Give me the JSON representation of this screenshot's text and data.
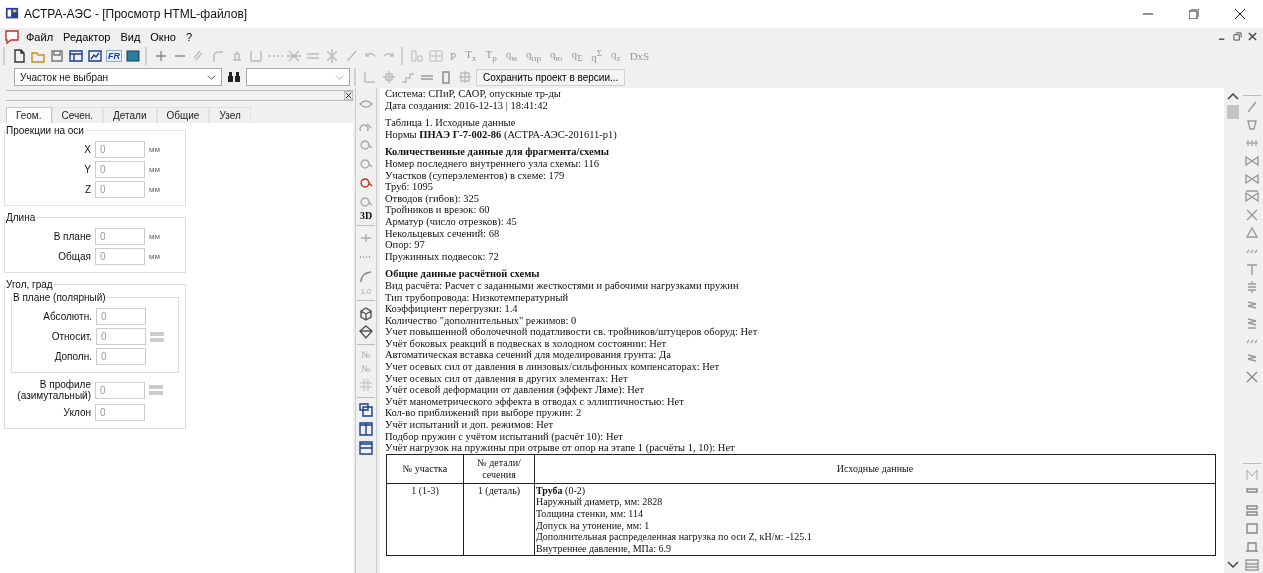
{
  "window": {
    "title": "АСТРА-АЭС - [Просмотр HTML-файлов]"
  },
  "menu": [
    "Файл",
    "Редактор",
    "Вид",
    "Окно",
    "?"
  ],
  "toolbar": {
    "logo_label": "FR",
    "text_buttons": [
      "P",
      "T$_{x}$",
      "T$_{p}$",
      "q$_{м}$",
      "q$_{пр}$",
      "q$_{ю}$",
      "q$_{Σ}$",
      "q$^{Σ}$",
      "q$_{z}$",
      "DxS"
    ]
  },
  "section_combo": {
    "value": "Участок не выбран"
  },
  "save_button": "Сохранить проект в версии...",
  "panel_tabs": [
    {
      "label": "Геом.",
      "selected": true
    },
    {
      "label": "Сечен.",
      "selected": false
    },
    {
      "label": "Детали",
      "selected": false
    },
    {
      "label": "Общие",
      "selected": false
    },
    {
      "label": "Узел",
      "selected": false
    }
  ],
  "groups": [
    {
      "title": "Проекции на оси",
      "fields": [
        {
          "label": "X",
          "value": "0",
          "unit": "мм",
          "spinner": false
        },
        {
          "label": "Y",
          "value": "0",
          "unit": "мм",
          "spinner": false
        },
        {
          "label": "Z",
          "value": "0",
          "unit": "мм",
          "spinner": false
        }
      ]
    },
    {
      "title": "Длина",
      "fields": [
        {
          "label": "В плане",
          "value": "0",
          "unit": "мм",
          "spinner": false
        },
        {
          "label": "Общая",
          "value": "0",
          "unit": "мм",
          "spinner": false
        }
      ]
    },
    {
      "title": "Угол, град",
      "subgroup": {
        "title": "В плане (полярный)",
        "fields": [
          {
            "label": "Абсолютн.",
            "value": "0",
            "spinner": false
          },
          {
            "label": "Относит.",
            "value": "0",
            "spinner": true
          },
          {
            "label": "Дополн.",
            "value": "0",
            "spinner": false
          }
        ]
      },
      "fields": [
        {
          "label": "В профиле (азимутальный)",
          "value": "0",
          "spinner": true
        },
        {
          "label": "Уклон",
          "value": "0",
          "spinner": false
        }
      ]
    }
  ],
  "side_toolbar_labels": [
    "3D",
    "1.0",
    "№",
    "№"
  ],
  "document": {
    "lines": [
      {
        "kind": "text",
        "text": "Система: СПиР, САОР, опускные тр-ды"
      },
      {
        "kind": "text",
        "text": "Дата создания: 2016-12-13 | 18:41:42"
      },
      {
        "kind": "gap"
      },
      {
        "kind": "text",
        "text": "Таблица 1. Исходные данные"
      },
      {
        "kind": "text",
        "text": "Нормы **ПНАЭ Г-7-002-86** (АСТРА-АЭС-201611-р1)"
      },
      {
        "kind": "gap"
      },
      {
        "kind": "heading",
        "text": "Количественные данные для фрагмента/схемы"
      },
      {
        "kind": "text",
        "text": "Номер последнего внутреннего узла схемы: 116"
      },
      {
        "kind": "text",
        "text": "Участков (суперэлементов) в схеме: 179"
      },
      {
        "kind": "text",
        "text": "Труб: 1095"
      },
      {
        "kind": "text",
        "text": "Отводов (гибов): 325"
      },
      {
        "kind": "text",
        "text": "Тройников и врезок: 60"
      },
      {
        "kind": "text",
        "text": "Арматур (число отрезков): 45"
      },
      {
        "kind": "text",
        "text": "Некольцевых сечений: 68"
      },
      {
        "kind": "text",
        "text": "Опор: 97"
      },
      {
        "kind": "text",
        "text": "Пружинных подвесок: 72"
      },
      {
        "kind": "gap"
      },
      {
        "kind": "heading",
        "text": "Общие данные расчётной схемы"
      },
      {
        "kind": "text",
        "text": "Вид расчёта: Расчет с заданными жесткостями и рабочими нагрузками пружин"
      },
      {
        "kind": "text",
        "text": "Тип трубопровода: Низкотемпературный"
      },
      {
        "kind": "text",
        "text": "Коэффициент перегрузки: 1.4"
      },
      {
        "kind": "text",
        "text": "Количество \"дополнительных\" режимов: 0"
      },
      {
        "kind": "text",
        "text": "Учет повышенной оболочечной податливости св. тройников/штуцеров оборуд: Нет"
      },
      {
        "kind": "text",
        "text": "Учёт боковых реакций в подвесках в холодном состоянии: Нет"
      },
      {
        "kind": "text",
        "text": "Автоматическая вставка сечений для моделирования грунта: Да"
      },
      {
        "kind": "text",
        "text": "Учет осевых сил от давления в линзовых/сильфонных компенсаторах: Нет"
      },
      {
        "kind": "text",
        "text": "Учет осевых сил от давления в других элементах: Нет"
      },
      {
        "kind": "text",
        "text": "Учёт осевой деформации от давления (эффект Ляме): Нет"
      },
      {
        "kind": "text",
        "text": "Учёт манометрического эффекта в отводах с эллиптичностью: Нет"
      },
      {
        "kind": "text",
        "text": "Кол-во приближений при выборе пружин: 2"
      },
      {
        "kind": "text",
        "text": "Учёт испытаний и доп. режимов: Нет"
      },
      {
        "kind": "text",
        "text": "Подбор пружин с учётом испытаний (расчёт 10): Нет"
      },
      {
        "kind": "text",
        "text": "Учёт нагрузок на пружины при отрыве от опор на этапе 1 (расчёты 1, 10): Нет"
      }
    ],
    "table": {
      "columns": [
        "№ участка",
        "№ детали/ сечения",
        "Исходные данные"
      ],
      "rows": [
        {
          "section": "1 (1-3)",
          "part": "1 (деталь)",
          "details": [
            "**Труба** (0-2)",
            "Наружный диаметр, мм: 2828",
            "Толщина стенки, мм: 114",
            "Допуск на утонение, мм: 1",
            "Дополнительная распределенная нагрузка по оси Z, кН/м: -125.1",
            "Внутреннее давление, МПа: 6.9"
          ]
        }
      ]
    }
  }
}
